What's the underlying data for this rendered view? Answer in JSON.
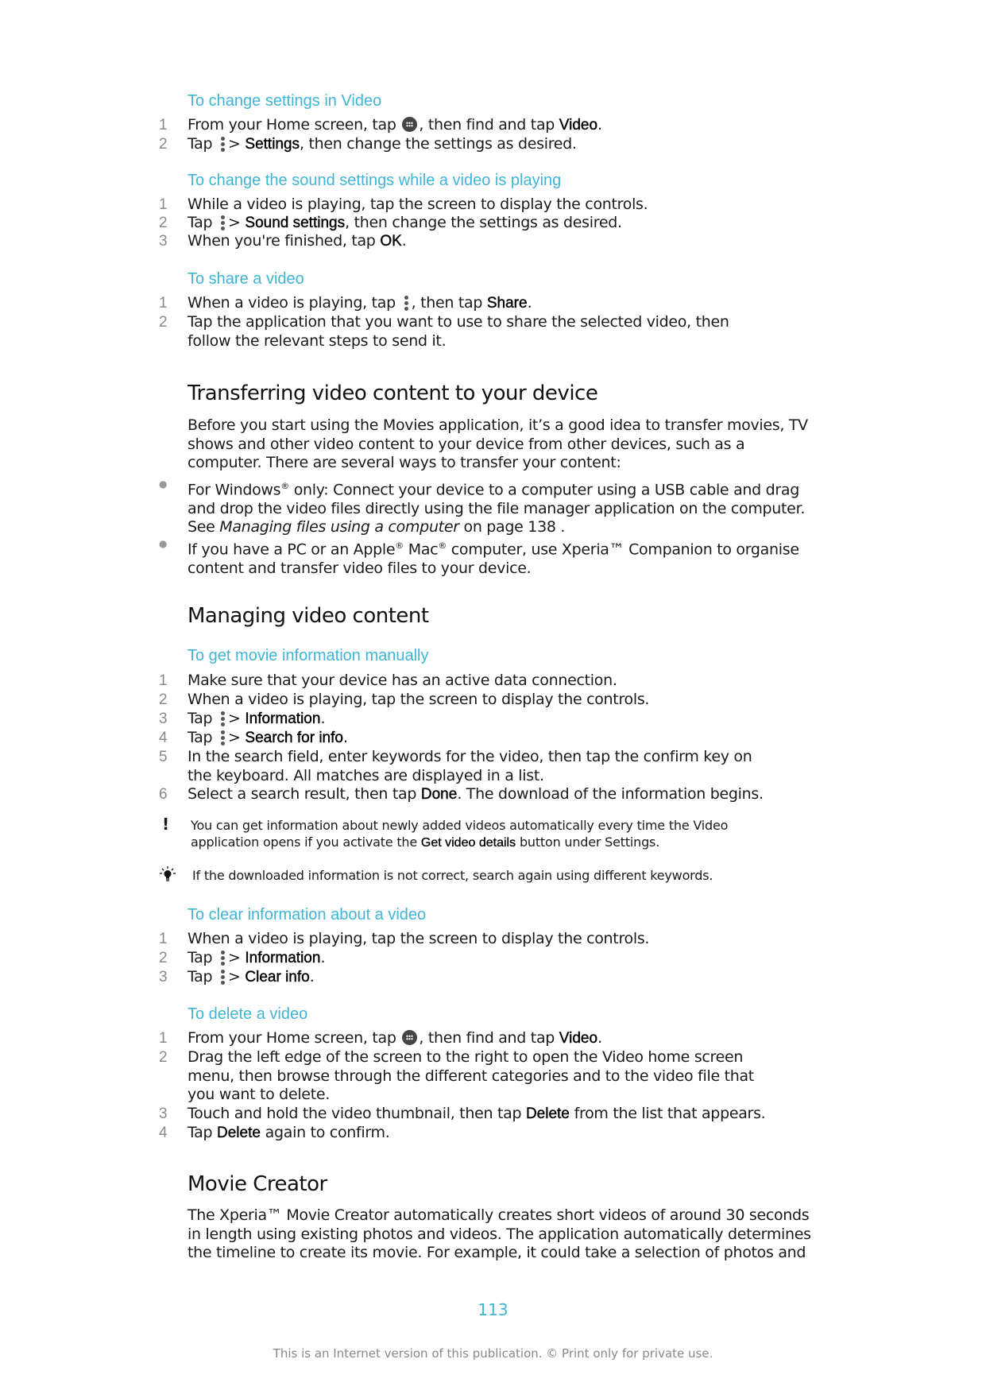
{
  "sections": {
    "change_settings": {
      "title": "To change settings in Video",
      "steps": [
        {
          "n": "1",
          "pre": "From your Home screen, tap ",
          "mid": ", then find and tap ",
          "bold": "Video",
          "post": "."
        },
        {
          "n": "2",
          "pre": "Tap ",
          "bold": "Settings",
          "post": ", then change the settings as desired."
        }
      ]
    },
    "sound_settings": {
      "title": "To change the sound settings while a video is playing",
      "steps": [
        {
          "n": "1",
          "text": "While a video is playing, tap the screen to display the controls."
        },
        {
          "n": "2",
          "pre": "Tap ",
          "bold": "Sound settings",
          "post": ", then change the settings as desired."
        },
        {
          "n": "3",
          "pre": "When you're finished, tap ",
          "bold": "OK",
          "post": "."
        }
      ]
    },
    "share_video": {
      "title": "To share a video",
      "steps": [
        {
          "n": "1",
          "pre": "When a video is playing, tap ",
          "mid": ", then tap ",
          "bold": "Share",
          "post": "."
        },
        {
          "n": "2",
          "line1": "Tap the application that you want to use to share the selected video, then",
          "line2": "follow the relevant steps to send it."
        }
      ]
    },
    "transferring": {
      "heading": "Transferring video content to your device",
      "intro": [
        "Before you start using the Movies application, it’s a good idea to transfer movies, TV",
        "shows and other video content to your device from other devices, such as a",
        "computer. There are several ways to transfer your content:"
      ],
      "bullets": [
        {
          "l1a": "For Windows",
          "l1sup": "®",
          "l1b": " only: Connect your device to a computer using a USB cable and drag",
          "l2": "and drop the video files directly using the file manager application on the computer.",
          "l3pre": "See ",
          "l3link": "Managing files using a computer",
          "l3post": " on page 138 ."
        },
        {
          "l1a": "If you have a PC or an Apple",
          "l1sup": "®",
          "l1b": " Mac",
          "l1sup2": "®",
          "l1c": " computer, use Xperia™  Companion to organise",
          "l2": "content and transfer video files to your device."
        }
      ]
    },
    "managing": {
      "heading": "Managing video content",
      "movie_info": {
        "title": "To get movie information manually",
        "steps": [
          {
            "n": "1",
            "text": "Make sure that your device has an active data connection."
          },
          {
            "n": "2",
            "text": "When a video is playing, tap the screen to display the controls."
          },
          {
            "n": "3",
            "pre": "Tap ",
            "bold": "Information",
            "post": "."
          },
          {
            "n": "4",
            "pre": "Tap ",
            "bold": "Search for info",
            "post": "."
          },
          {
            "n": "5",
            "line1": "In the search field, enter keywords for the video, then tap the confirm key on",
            "line2": "the keyboard. All matches are displayed in a list."
          },
          {
            "n": "6",
            "pre": "Select a search result, then tap ",
            "bold": "Done",
            "post": ". The download of the information begins."
          }
        ]
      },
      "note": {
        "icon": "exclamation-icon",
        "line1": "You can get information about newly added videos automatically every time the Video",
        "line2pre": "application opens if you activate the ",
        "line2bold": "Get video details",
        "line2post": " button under Settings."
      },
      "tip": {
        "icon": "lightbulb-icon",
        "text": "If the downloaded information is not correct, search again using different keywords."
      },
      "clear_info": {
        "title": "To clear information about a video",
        "steps": [
          {
            "n": "1",
            "text": "When a video is playing, tap the screen to display the controls."
          },
          {
            "n": "2",
            "pre": "Tap ",
            "bold": "Information",
            "post": "."
          },
          {
            "n": "3",
            "pre": "Tap ",
            "bold": "Clear info",
            "post": "."
          }
        ]
      },
      "delete_video": {
        "title": "To delete a video",
        "steps": [
          {
            "n": "1",
            "pre": "From your Home screen, tap ",
            "mid": ", then find and tap ",
            "bold": "Video",
            "post": "."
          },
          {
            "n": "2",
            "line1": "Drag the left edge of the screen to the right to open the Video home screen",
            "line2": "menu, then browse through the different categories and to the video file that",
            "line3": "you want to delete."
          },
          {
            "n": "3",
            "pre": "Touch and hold the video thumbnail, then tap ",
            "bold": "Delete",
            "post": " from the list that appears."
          },
          {
            "n": "4",
            "pre": "Tap ",
            "bold": "Delete",
            "post": " again to confirm."
          }
        ]
      }
    },
    "movie_creator": {
      "heading": "Movie Creator",
      "lines": [
        "The Xperia™  Movie Creator automatically creates short videos of around 30 seconds",
        "in length using existing photos and videos. The application automatically determines",
        "the timeline to create its movie. For example, it could take a selection of photos and"
      ]
    }
  },
  "page_number": "113",
  "footer": "This is an Internet version of this publication. © Print only for private use.",
  "colors": {
    "accent": "#3fb5d6",
    "text": "#1a1a1a",
    "muted": "#888888"
  }
}
